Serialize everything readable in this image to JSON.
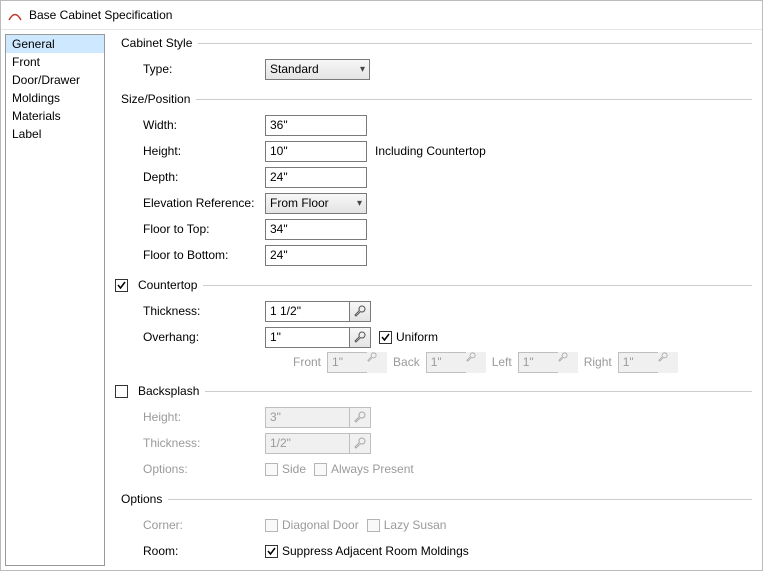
{
  "window": {
    "title": "Base Cabinet Specification"
  },
  "sidebar": {
    "items": [
      {
        "label": "General",
        "selected": true
      },
      {
        "label": "Front"
      },
      {
        "label": "Door/Drawer"
      },
      {
        "label": "Moldings"
      },
      {
        "label": "Materials"
      },
      {
        "label": "Label"
      }
    ]
  },
  "cabinetStyle": {
    "title": "Cabinet Style",
    "typeLabel": "Type:",
    "typeValue": "Standard"
  },
  "sizePosition": {
    "title": "Size/Position",
    "widthLabel": "Width:",
    "widthValue": "36\"",
    "heightLabel": "Height:",
    "heightValue": "10\"",
    "heightNote": "Including Countertop",
    "depthLabel": "Depth:",
    "depthValue": "24\"",
    "elevRefLabel": "Elevation Reference:",
    "elevRefValue": "From Floor",
    "floorTopLabel": "Floor to Top:",
    "floorTopValue": "34\"",
    "floorBottomLabel": "Floor to Bottom:",
    "floorBottomValue": "24\""
  },
  "countertop": {
    "title": "Countertop",
    "enabled": true,
    "thicknessLabel": "Thickness:",
    "thicknessValue": "1 1/2\"",
    "overhangLabel": "Overhang:",
    "overhangValue": "1\"",
    "uniformLabel": "Uniform",
    "uniform": true,
    "sides": {
      "frontLabel": "Front",
      "frontValue": "1\"",
      "backLabel": "Back",
      "backValue": "1\"",
      "leftLabel": "Left",
      "leftValue": "1\"",
      "rightLabel": "Right",
      "rightValue": "1\""
    }
  },
  "backsplash": {
    "title": "Backsplash",
    "enabled": false,
    "heightLabel": "Height:",
    "heightValue": "3\"",
    "thicknessLabel": "Thickness:",
    "thicknessValue": "1/2\"",
    "optionsLabel": "Options:",
    "sideLabel": "Side",
    "alwaysLabel": "Always Present"
  },
  "options": {
    "title": "Options",
    "cornerLabel": "Corner:",
    "diagLabel": "Diagonal Door",
    "lazyLabel": "Lazy Susan",
    "roomLabel": "Room:",
    "suppressLabel": "Suppress Adjacent Room Moldings",
    "suppress": true
  }
}
